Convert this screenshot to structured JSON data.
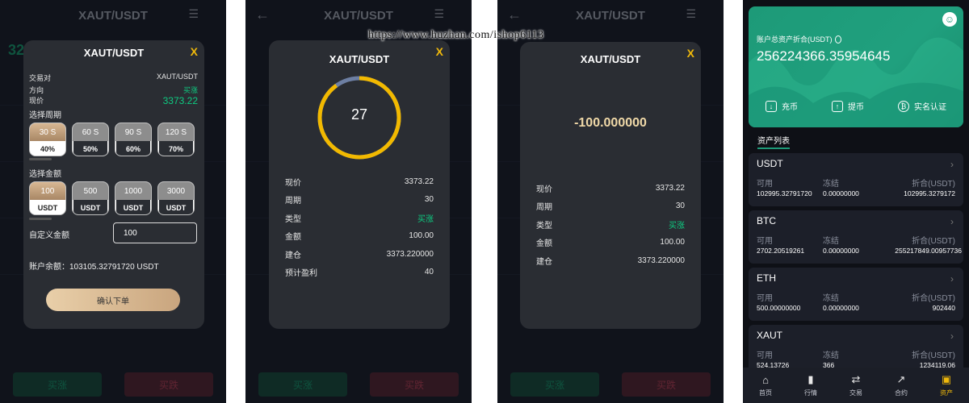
{
  "watermark": "https://www.huzhan.com/ishop6113",
  "background_app": {
    "title": "XAUT/USDT",
    "back_icon": "arrow-left-icon",
    "menu_icon": "menu-icon",
    "buy_up_label": "买涨",
    "buy_down_label": "买跌"
  },
  "order_modal": {
    "title": "XAUT/USDT",
    "close_label": "X",
    "pair_label": "交易对",
    "pair_value": "XAUT/USDT",
    "direction_label": "方向",
    "direction_value": "买涨",
    "price_label": "现价",
    "price_value": "3373.22",
    "period_section": "选择周期",
    "periods": [
      {
        "time": "30 S",
        "rate": "40%"
      },
      {
        "time": "60 S",
        "rate": "50%"
      },
      {
        "time": "90 S",
        "rate": "60%"
      },
      {
        "time": "120 S",
        "rate": "70%"
      }
    ],
    "selected_period": 0,
    "amount_section": "选择金额",
    "amounts": [
      {
        "value": "100",
        "unit": "USDT"
      },
      {
        "value": "500",
        "unit": "USDT"
      },
      {
        "value": "1000",
        "unit": "USDT"
      },
      {
        "value": "3000",
        "unit": "USDT"
      }
    ],
    "selected_amount": 0,
    "custom_label": "自定义金额",
    "custom_value": "100",
    "balance_text": "账户余额：103105.32791720 USDT",
    "confirm_label": "确认下单"
  },
  "countdown_modal": {
    "title": "XAUT/USDT",
    "close_label": "X",
    "countdown": "27",
    "countdown_progress": 0.9,
    "rows": [
      {
        "label": "现价",
        "value": "3373.22"
      },
      {
        "label": "周期",
        "value": "30"
      },
      {
        "label": "类型",
        "value": "买涨"
      },
      {
        "label": "金额",
        "value": "100.00"
      },
      {
        "label": "建仓",
        "value": "3373.220000"
      },
      {
        "label": "预计盈利",
        "value": "40"
      }
    ]
  },
  "result_modal": {
    "title": "XAUT/USDT",
    "close_label": "X",
    "result": "-100.000000",
    "rows": [
      {
        "label": "现价",
        "value": "3373.22"
      },
      {
        "label": "周期",
        "value": "30"
      },
      {
        "label": "类型",
        "value": "买涨"
      },
      {
        "label": "金额",
        "value": "100.00"
      },
      {
        "label": "建仓",
        "value": "3373.220000"
      }
    ]
  },
  "assets": {
    "header_label": "账户总资产折合(USDT)",
    "total": "256224366.35954645",
    "actions": [
      {
        "label": "充币",
        "icon": "deposit-icon"
      },
      {
        "label": "提币",
        "icon": "withdraw-icon"
      },
      {
        "label": "实名认证",
        "icon": "verify-icon"
      }
    ],
    "list_title": "资产列表",
    "col_available": "可用",
    "col_frozen": "冻结",
    "col_equiv": "折合(USDT)",
    "items": [
      {
        "symbol": "USDT",
        "available": "102995.32791720",
        "frozen": "0.00000000",
        "equiv": "102995.3279172"
      },
      {
        "symbol": "BTC",
        "available": "2702.20519261",
        "frozen": "0.00000000",
        "equiv": "255217849.00957736"
      },
      {
        "symbol": "ETH",
        "available": "500.00000000",
        "frozen": "0.00000000",
        "equiv": "902440"
      },
      {
        "symbol": "XAUT",
        "available": "524.13726",
        "frozen": "366",
        "equiv": "1234119.06"
      }
    ],
    "tabs": [
      {
        "label": "首页",
        "icon": "home-icon"
      },
      {
        "label": "行情",
        "icon": "chart-bars-icon"
      },
      {
        "label": "交易",
        "icon": "exchange-icon"
      },
      {
        "label": "合约",
        "icon": "trend-icon"
      },
      {
        "label": "资产",
        "icon": "wallet-icon"
      }
    ],
    "active_tab": 4
  }
}
